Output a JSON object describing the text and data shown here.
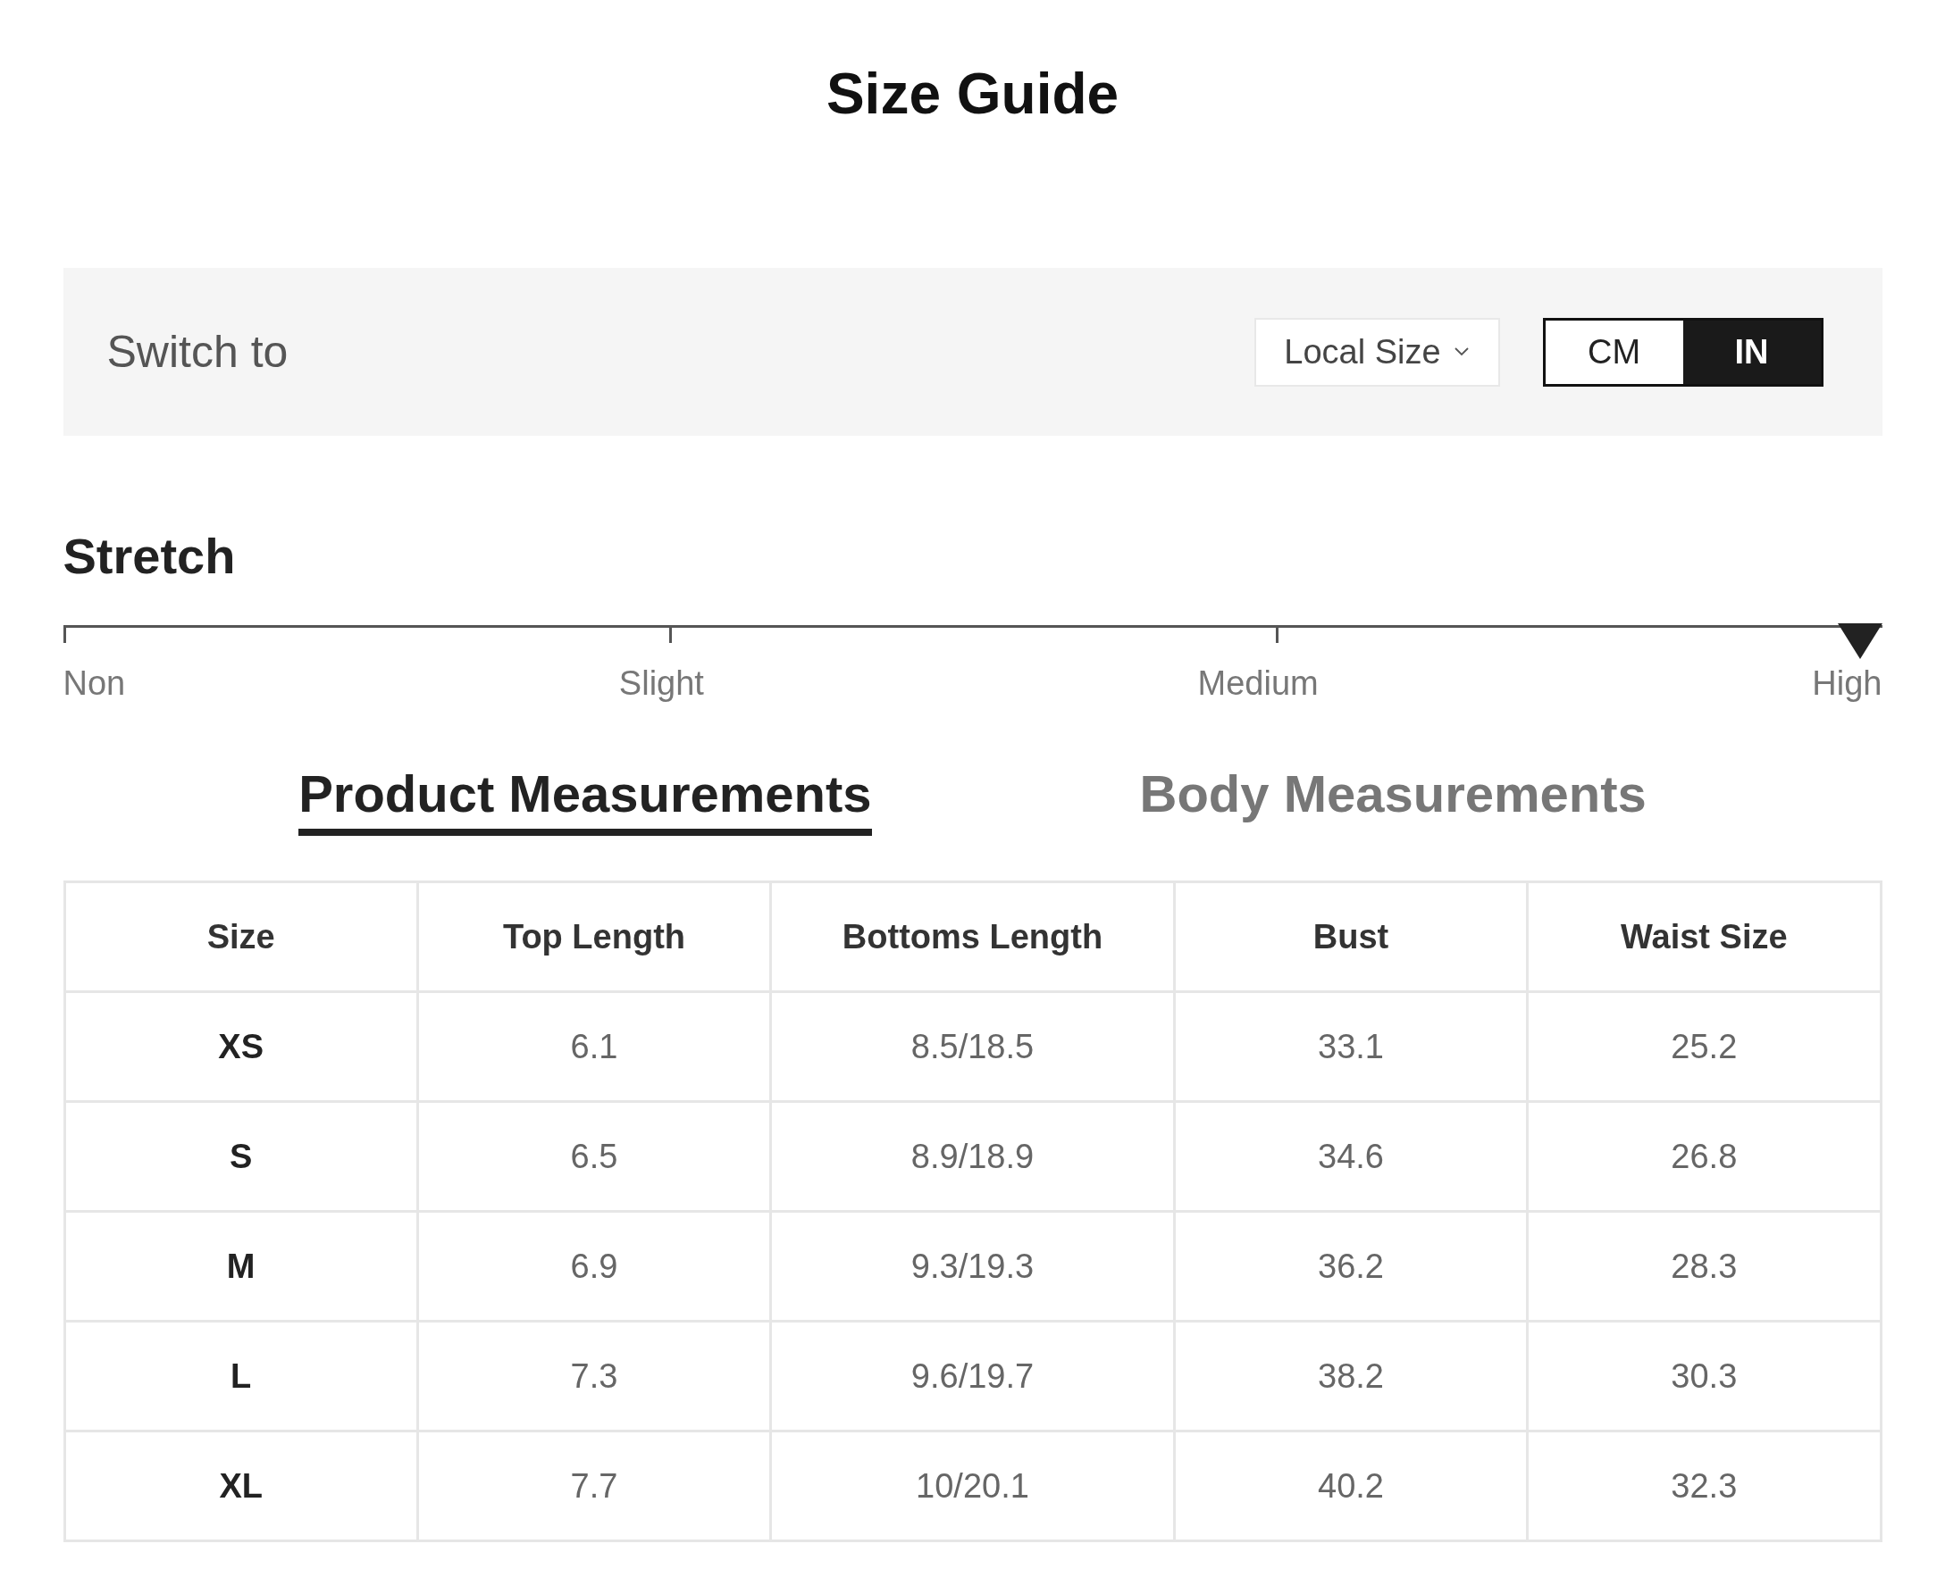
{
  "title": "Size Guide",
  "switch_bar": {
    "label": "Switch to",
    "size_dropdown": {
      "label": "Local Size"
    },
    "units": [
      {
        "label": "CM",
        "selected": false
      },
      {
        "label": "IN",
        "selected": true
      }
    ]
  },
  "stretch": {
    "title": "Stretch",
    "level": 1,
    "labels": [
      "Non",
      "Slight",
      "Medium",
      "High"
    ]
  },
  "tabs": [
    {
      "label": "Product Measurements",
      "selected": true
    },
    {
      "label": "Body Measurements",
      "selected": false
    }
  ],
  "table": {
    "columns": [
      "Size",
      "Top Length",
      "Bottoms Length",
      "Bust",
      "Waist Size"
    ],
    "rows": [
      [
        "XS",
        "6.1",
        "8.5/18.5",
        "33.1",
        "25.2"
      ],
      [
        "S",
        "6.5",
        "8.9/18.9",
        "34.6",
        "26.8"
      ],
      [
        "M",
        "6.9",
        "9.3/19.3",
        "36.2",
        "28.3"
      ],
      [
        "L",
        "7.3",
        "9.6/19.7",
        "38.2",
        "30.3"
      ],
      [
        "XL",
        "7.7",
        "10/20.1",
        "40.2",
        "32.3"
      ]
    ]
  }
}
